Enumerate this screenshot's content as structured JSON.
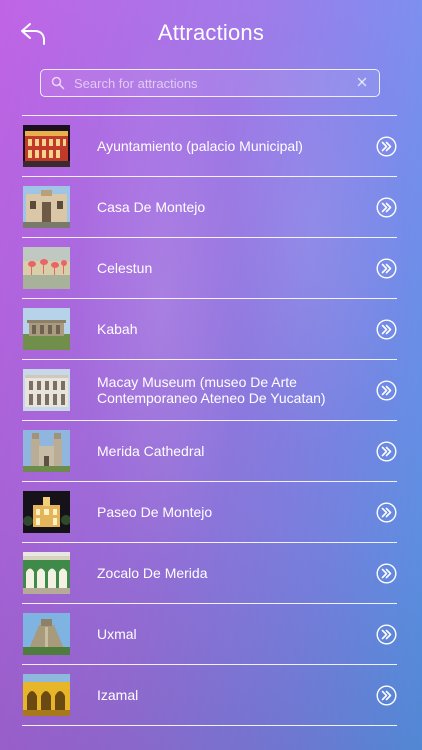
{
  "header": {
    "title": "Attractions",
    "back_icon": "back-arrow-icon"
  },
  "search": {
    "placeholder": "Search for attractions",
    "value": "",
    "search_icon": "search-icon",
    "clear_icon": "close-icon"
  },
  "attractions": [
    {
      "label": "Ayuntamiento (palacio Municipal)",
      "thumb": "building-night"
    },
    {
      "label": "Casa De Montejo",
      "thumb": "colonial-facade"
    },
    {
      "label": "Celestun",
      "thumb": "flamingos"
    },
    {
      "label": "Kabah",
      "thumb": "ruins"
    },
    {
      "label": "Macay Museum (museo De Arte Contemporaneo Ateneo De Yucatan)",
      "thumb": "museum-facade"
    },
    {
      "label": "Merida Cathedral",
      "thumb": "cathedral"
    },
    {
      "label": "Paseo De Montejo",
      "thumb": "lit-building-night"
    },
    {
      "label": "Zocalo De Merida",
      "thumb": "arcade-courtyard"
    },
    {
      "label": "Uxmal",
      "thumb": "pyramid"
    },
    {
      "label": "Izamal",
      "thumb": "yellow-arches"
    }
  ],
  "colors": {
    "bg_left": "#c064e6",
    "bg_right": "#5aa3f5",
    "text": "#ffffff"
  }
}
